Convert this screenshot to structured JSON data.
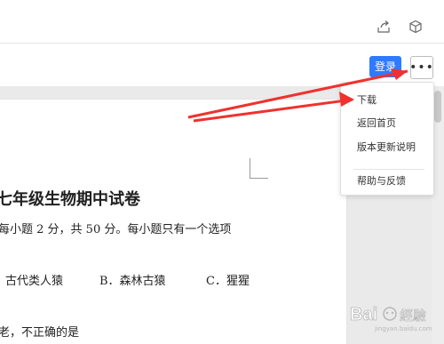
{
  "topbar": {
    "share_icon": "share-icon",
    "box_icon": "cube-icon"
  },
  "toolbar": {
    "login_label": "登录",
    "more_label": "•••"
  },
  "menu": {
    "items": [
      "下载",
      "返回首页",
      "版本更新说明",
      "帮助与反馈"
    ]
  },
  "document": {
    "title": "七年级生物期中试卷",
    "line1": "每小题 2 分，共 50 分。每小题只有一个选项",
    "options": [
      "古代类人猿",
      "B．森林古猿",
      "C．猩猩"
    ],
    "line3": "老，不正确的是"
  },
  "watermark": {
    "text": "Bai經驗",
    "subtext": "jingyan.baidu.com"
  },
  "colors": {
    "accent": "#2f7bff",
    "arrow": "#f0312d"
  }
}
